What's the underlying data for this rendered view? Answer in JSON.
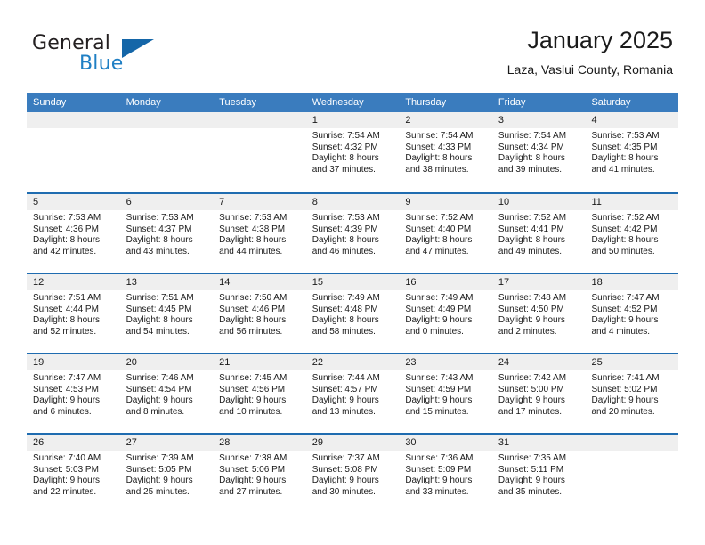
{
  "logo": {
    "primary_text": "General",
    "secondary_text": "Blue",
    "primary_color": "#231f20",
    "secondary_color": "#1f7fc4",
    "triangle_color": "#1466a8"
  },
  "header": {
    "title": "January 2025",
    "subtitle": "Laza, Vaslui County, Romania"
  },
  "theme": {
    "header_bg": "#3a7cbe",
    "row_divider": "#1f6cb0",
    "day_number_bg": "#efefef",
    "cell_bg": "#ffffff",
    "text": "#1a1a1a"
  },
  "weekdays": [
    "Sunday",
    "Monday",
    "Tuesday",
    "Wednesday",
    "Thursday",
    "Friday",
    "Saturday"
  ],
  "weeks": [
    [
      {
        "day": "",
        "empty": true
      },
      {
        "day": "",
        "empty": true
      },
      {
        "day": "",
        "empty": true
      },
      {
        "day": "1",
        "sunrise": "Sunrise: 7:54 AM",
        "sunset": "Sunset: 4:32 PM",
        "daylight1": "Daylight: 8 hours",
        "daylight2": "and 37 minutes."
      },
      {
        "day": "2",
        "sunrise": "Sunrise: 7:54 AM",
        "sunset": "Sunset: 4:33 PM",
        "daylight1": "Daylight: 8 hours",
        "daylight2": "and 38 minutes."
      },
      {
        "day": "3",
        "sunrise": "Sunrise: 7:54 AM",
        "sunset": "Sunset: 4:34 PM",
        "daylight1": "Daylight: 8 hours",
        "daylight2": "and 39 minutes."
      },
      {
        "day": "4",
        "sunrise": "Sunrise: 7:53 AM",
        "sunset": "Sunset: 4:35 PM",
        "daylight1": "Daylight: 8 hours",
        "daylight2": "and 41 minutes."
      }
    ],
    [
      {
        "day": "5",
        "sunrise": "Sunrise: 7:53 AM",
        "sunset": "Sunset: 4:36 PM",
        "daylight1": "Daylight: 8 hours",
        "daylight2": "and 42 minutes."
      },
      {
        "day": "6",
        "sunrise": "Sunrise: 7:53 AM",
        "sunset": "Sunset: 4:37 PM",
        "daylight1": "Daylight: 8 hours",
        "daylight2": "and 43 minutes."
      },
      {
        "day": "7",
        "sunrise": "Sunrise: 7:53 AM",
        "sunset": "Sunset: 4:38 PM",
        "daylight1": "Daylight: 8 hours",
        "daylight2": "and 44 minutes."
      },
      {
        "day": "8",
        "sunrise": "Sunrise: 7:53 AM",
        "sunset": "Sunset: 4:39 PM",
        "daylight1": "Daylight: 8 hours",
        "daylight2": "and 46 minutes."
      },
      {
        "day": "9",
        "sunrise": "Sunrise: 7:52 AM",
        "sunset": "Sunset: 4:40 PM",
        "daylight1": "Daylight: 8 hours",
        "daylight2": "and 47 minutes."
      },
      {
        "day": "10",
        "sunrise": "Sunrise: 7:52 AM",
        "sunset": "Sunset: 4:41 PM",
        "daylight1": "Daylight: 8 hours",
        "daylight2": "and 49 minutes."
      },
      {
        "day": "11",
        "sunrise": "Sunrise: 7:52 AM",
        "sunset": "Sunset: 4:42 PM",
        "daylight1": "Daylight: 8 hours",
        "daylight2": "and 50 minutes."
      }
    ],
    [
      {
        "day": "12",
        "sunrise": "Sunrise: 7:51 AM",
        "sunset": "Sunset: 4:44 PM",
        "daylight1": "Daylight: 8 hours",
        "daylight2": "and 52 minutes."
      },
      {
        "day": "13",
        "sunrise": "Sunrise: 7:51 AM",
        "sunset": "Sunset: 4:45 PM",
        "daylight1": "Daylight: 8 hours",
        "daylight2": "and 54 minutes."
      },
      {
        "day": "14",
        "sunrise": "Sunrise: 7:50 AM",
        "sunset": "Sunset: 4:46 PM",
        "daylight1": "Daylight: 8 hours",
        "daylight2": "and 56 minutes."
      },
      {
        "day": "15",
        "sunrise": "Sunrise: 7:49 AM",
        "sunset": "Sunset: 4:48 PM",
        "daylight1": "Daylight: 8 hours",
        "daylight2": "and 58 minutes."
      },
      {
        "day": "16",
        "sunrise": "Sunrise: 7:49 AM",
        "sunset": "Sunset: 4:49 PM",
        "daylight1": "Daylight: 9 hours",
        "daylight2": "and 0 minutes."
      },
      {
        "day": "17",
        "sunrise": "Sunrise: 7:48 AM",
        "sunset": "Sunset: 4:50 PM",
        "daylight1": "Daylight: 9 hours",
        "daylight2": "and 2 minutes."
      },
      {
        "day": "18",
        "sunrise": "Sunrise: 7:47 AM",
        "sunset": "Sunset: 4:52 PM",
        "daylight1": "Daylight: 9 hours",
        "daylight2": "and 4 minutes."
      }
    ],
    [
      {
        "day": "19",
        "sunrise": "Sunrise: 7:47 AM",
        "sunset": "Sunset: 4:53 PM",
        "daylight1": "Daylight: 9 hours",
        "daylight2": "and 6 minutes."
      },
      {
        "day": "20",
        "sunrise": "Sunrise: 7:46 AM",
        "sunset": "Sunset: 4:54 PM",
        "daylight1": "Daylight: 9 hours",
        "daylight2": "and 8 minutes."
      },
      {
        "day": "21",
        "sunrise": "Sunrise: 7:45 AM",
        "sunset": "Sunset: 4:56 PM",
        "daylight1": "Daylight: 9 hours",
        "daylight2": "and 10 minutes."
      },
      {
        "day": "22",
        "sunrise": "Sunrise: 7:44 AM",
        "sunset": "Sunset: 4:57 PM",
        "daylight1": "Daylight: 9 hours",
        "daylight2": "and 13 minutes."
      },
      {
        "day": "23",
        "sunrise": "Sunrise: 7:43 AM",
        "sunset": "Sunset: 4:59 PM",
        "daylight1": "Daylight: 9 hours",
        "daylight2": "and 15 minutes."
      },
      {
        "day": "24",
        "sunrise": "Sunrise: 7:42 AM",
        "sunset": "Sunset: 5:00 PM",
        "daylight1": "Daylight: 9 hours",
        "daylight2": "and 17 minutes."
      },
      {
        "day": "25",
        "sunrise": "Sunrise: 7:41 AM",
        "sunset": "Sunset: 5:02 PM",
        "daylight1": "Daylight: 9 hours",
        "daylight2": "and 20 minutes."
      }
    ],
    [
      {
        "day": "26",
        "sunrise": "Sunrise: 7:40 AM",
        "sunset": "Sunset: 5:03 PM",
        "daylight1": "Daylight: 9 hours",
        "daylight2": "and 22 minutes."
      },
      {
        "day": "27",
        "sunrise": "Sunrise: 7:39 AM",
        "sunset": "Sunset: 5:05 PM",
        "daylight1": "Daylight: 9 hours",
        "daylight2": "and 25 minutes."
      },
      {
        "day": "28",
        "sunrise": "Sunrise: 7:38 AM",
        "sunset": "Sunset: 5:06 PM",
        "daylight1": "Daylight: 9 hours",
        "daylight2": "and 27 minutes."
      },
      {
        "day": "29",
        "sunrise": "Sunrise: 7:37 AM",
        "sunset": "Sunset: 5:08 PM",
        "daylight1": "Daylight: 9 hours",
        "daylight2": "and 30 minutes."
      },
      {
        "day": "30",
        "sunrise": "Sunrise: 7:36 AM",
        "sunset": "Sunset: 5:09 PM",
        "daylight1": "Daylight: 9 hours",
        "daylight2": "and 33 minutes."
      },
      {
        "day": "31",
        "sunrise": "Sunrise: 7:35 AM",
        "sunset": "Sunset: 5:11 PM",
        "daylight1": "Daylight: 9 hours",
        "daylight2": "and 35 minutes."
      },
      {
        "day": "",
        "empty": true
      }
    ]
  ]
}
